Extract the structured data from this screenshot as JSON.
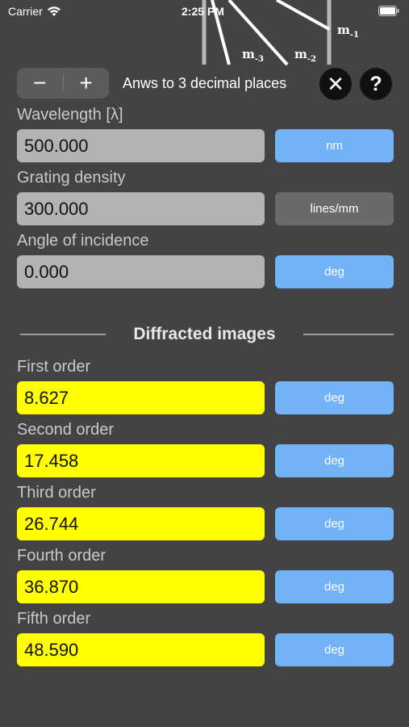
{
  "status_bar": {
    "carrier": "Carrier",
    "time": "2:25 PM"
  },
  "diagram": {
    "labels": [
      {
        "base": "m",
        "sub": "-3"
      },
      {
        "base": "m",
        "sub": "-2"
      },
      {
        "base": "m",
        "sub": "-1"
      }
    ]
  },
  "controls": {
    "minus": "−",
    "plus": "+",
    "decimal_text": "Anws to 3 decimal places",
    "close": "✕",
    "help": "?"
  },
  "inputs": [
    {
      "label": "Wavelength [λ]",
      "value": "500.000",
      "unit": "nm"
    },
    {
      "label": "Grating density",
      "value": "300.000",
      "unit": "lines/mm"
    },
    {
      "label": "Angle of incidence",
      "value": "0.000",
      "unit": "deg"
    }
  ],
  "section_title": "Diffracted images",
  "results": [
    {
      "label": "First order",
      "value": "8.627",
      "unit": "deg"
    },
    {
      "label": "Second order",
      "value": "17.458",
      "unit": "deg"
    },
    {
      "label": "Third order",
      "value": "26.744",
      "unit": "deg"
    },
    {
      "label": "Fourth order",
      "value": "36.870",
      "unit": "deg"
    },
    {
      "label": "Fifth order",
      "value": "48.590",
      "unit": "deg"
    }
  ],
  "colors": {
    "background": "#434343",
    "input_fill": "#b3b3b3",
    "result_fill": "#ffff00",
    "unit_button": "#72b2f7"
  }
}
